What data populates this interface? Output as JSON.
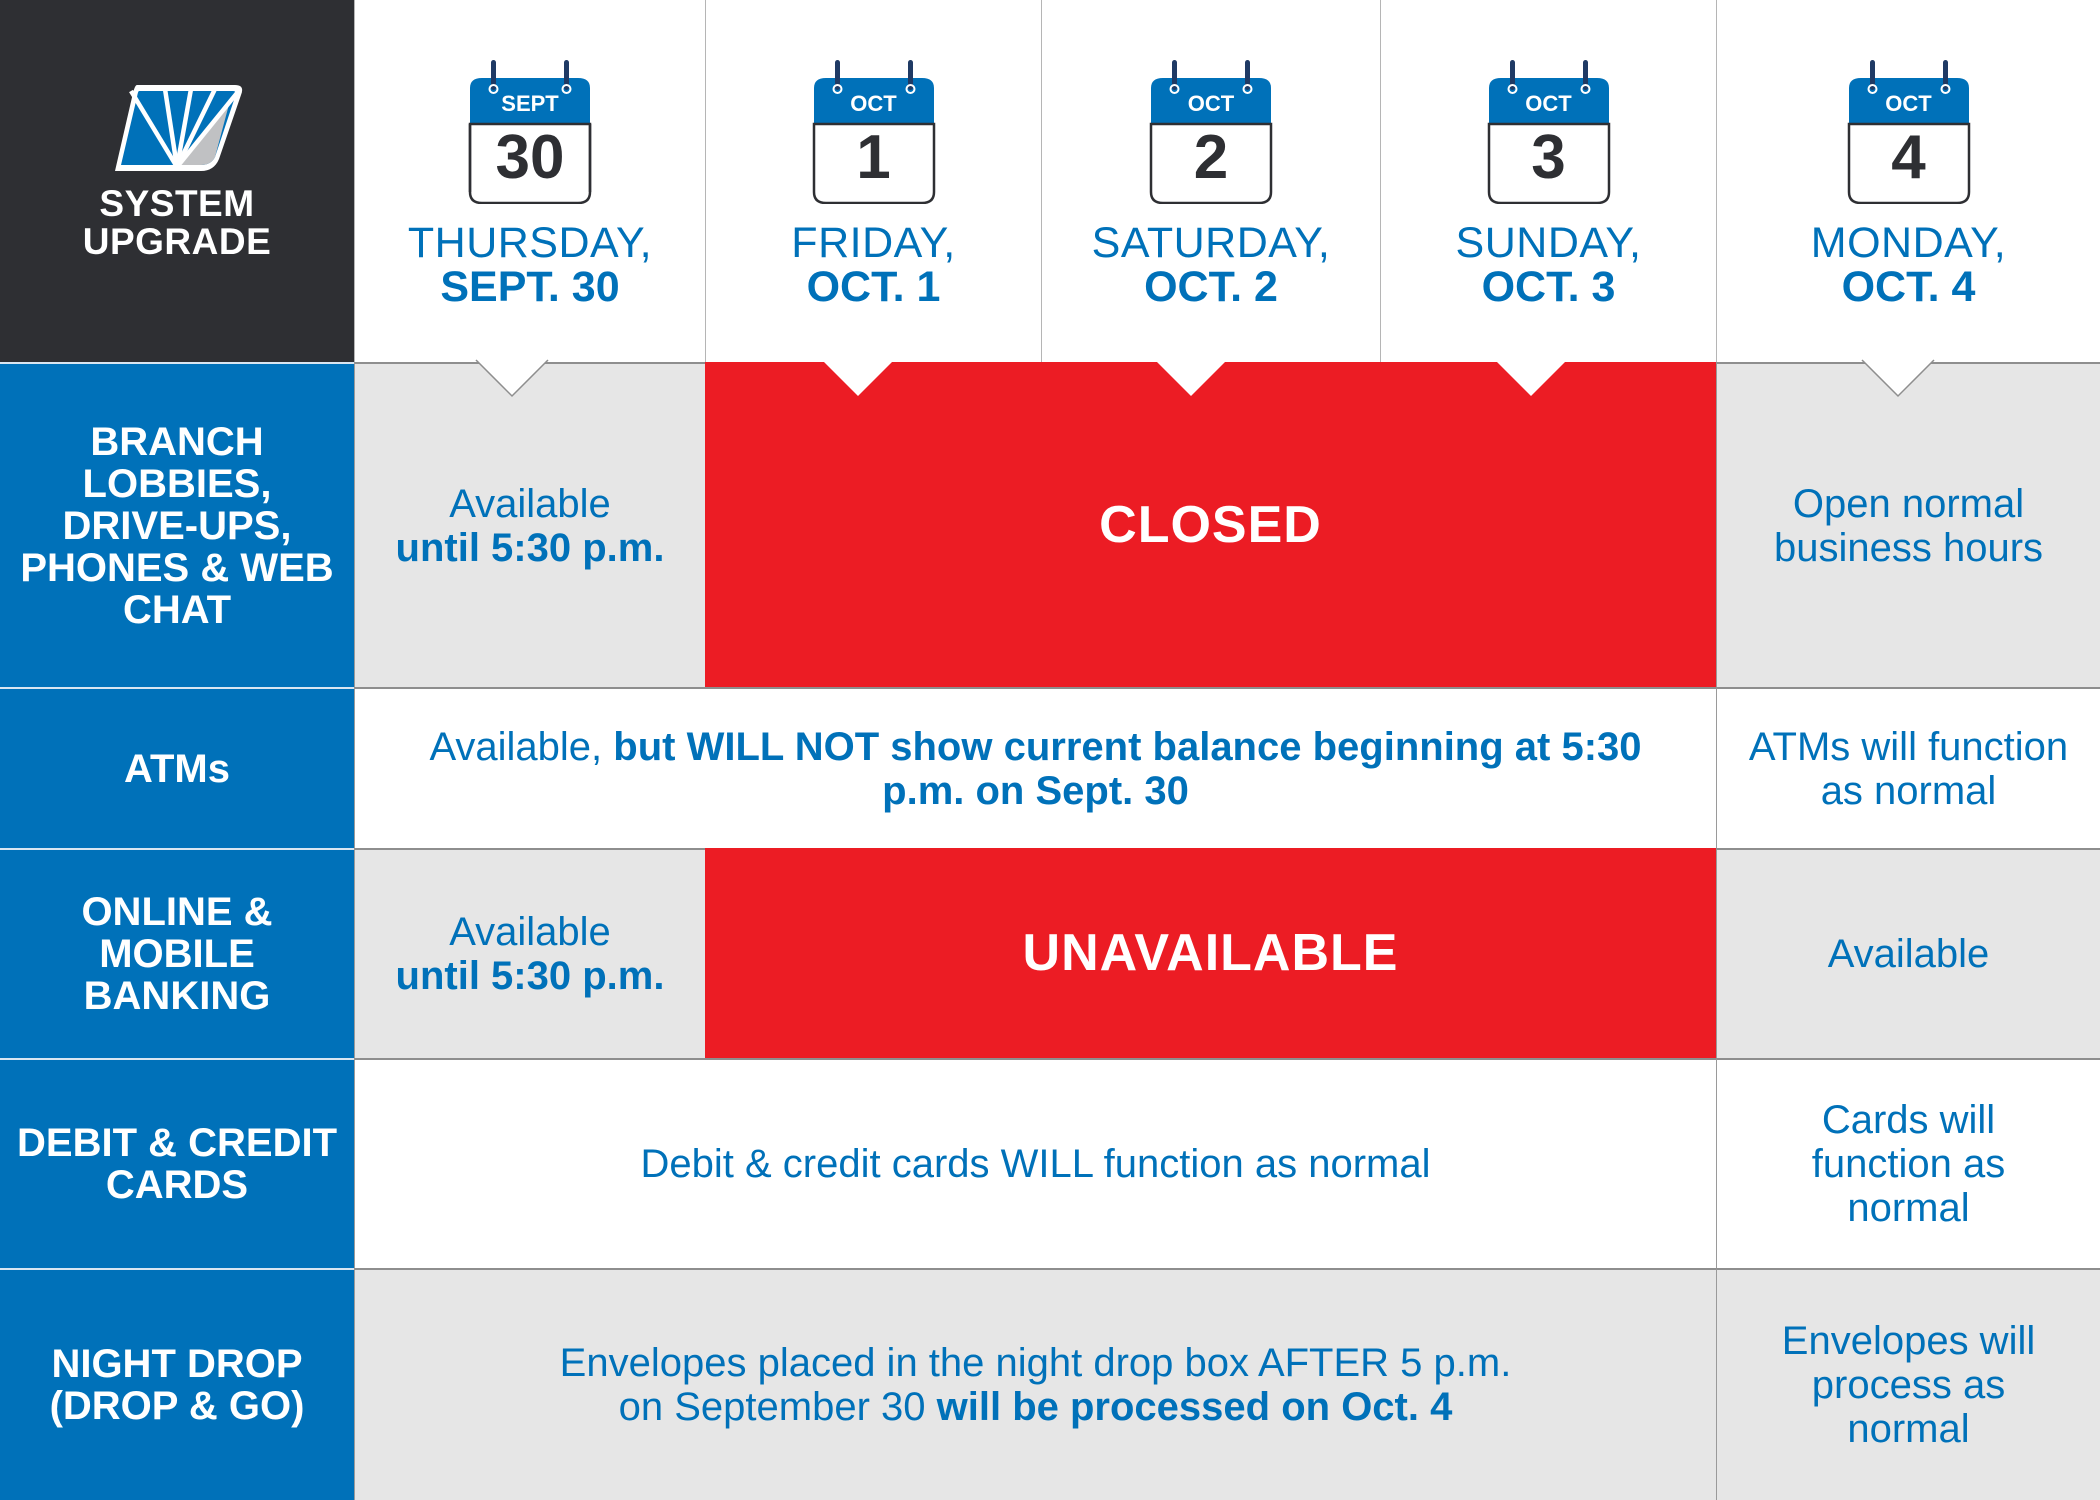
{
  "brand": {
    "logo_icon": "fan-rays-parallelogram-logo",
    "title_line1": "SYSTEM",
    "title_line2": "UPGRADE"
  },
  "colors": {
    "dark": "#2e2f33",
    "brand_blue": "#0071b9",
    "alert_red": "#ec1c24",
    "light_gray": "#e6e6e6",
    "logo_gray": "#c0c1c3",
    "ring_navy": "#1f3a64"
  },
  "days": [
    {
      "cal_month": "SEPT",
      "cal_day": "30",
      "day_name": "THURSDAY,",
      "date_label": "SEPT. 30"
    },
    {
      "cal_month": "OCT",
      "cal_day": "1",
      "day_name": "FRIDAY,",
      "date_label": "OCT. 1"
    },
    {
      "cal_month": "OCT",
      "cal_day": "2",
      "day_name": "SATURDAY,",
      "date_label": "OCT. 2"
    },
    {
      "cal_month": "OCT",
      "cal_day": "3",
      "day_name": "SUNDAY,",
      "date_label": "OCT. 3"
    },
    {
      "cal_month": "OCT",
      "cal_day": "4",
      "day_name": "MONDAY,",
      "date_label": "OCT. 4"
    }
  ],
  "rows": [
    {
      "label": "BRANCH LOBBIES, DRIVE-UPS, PHONES & WEB CHAT",
      "sept30": {
        "line1": "Available",
        "line2_bold": "until 5:30 p.m."
      },
      "oct1_3": {
        "status": "CLOSED"
      },
      "oct4": {
        "text": "Open normal business hours"
      }
    },
    {
      "label": "ATMs",
      "sept30_oct3": {
        "prefix": "Available, ",
        "bold": "but WILL NOT show current balance beginning at 5:30 p.m. on Sept. 30"
      },
      "oct4": {
        "text": "ATMs will function as normal"
      }
    },
    {
      "label": "ONLINE & MOBILE BANKING",
      "sept30": {
        "line1": "Available",
        "line2_bold": "until 5:30 p.m."
      },
      "oct1_3": {
        "status": "UNAVAILABLE"
      },
      "oct4": {
        "text": "Available"
      }
    },
    {
      "label": "DEBIT & CREDIT CARDS",
      "sept30_oct3": {
        "text": "Debit & credit cards WILL function as normal"
      },
      "oct4": {
        "text": "Cards will function as normal"
      }
    },
    {
      "label": "NIGHT DROP (DROP & GO)",
      "sept30_oct3": {
        "line1": "Envelopes placed in the night drop box AFTER 5 p.m.",
        "line2_prefix": "on September 30 ",
        "line2_bold": "will be processed on Oct. 4"
      },
      "oct4": {
        "text": "Envelopes will process as normal"
      }
    }
  ]
}
